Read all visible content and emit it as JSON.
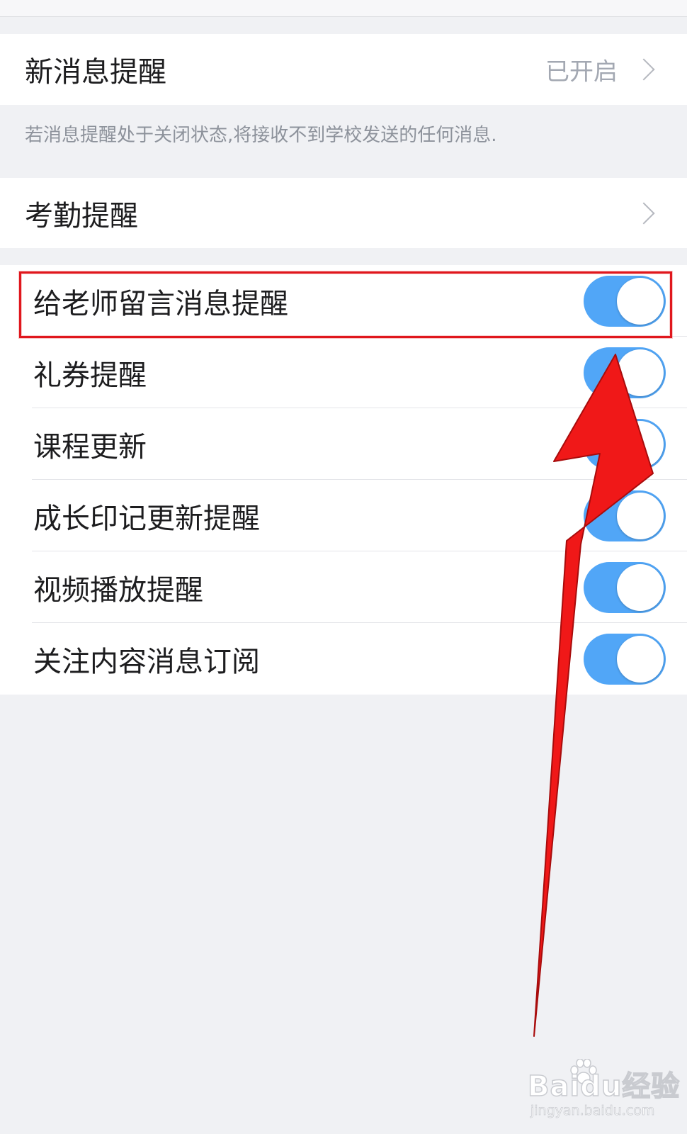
{
  "notification_row": {
    "title": "新消息提醒",
    "value": "已开启"
  },
  "notification_hint": "若消息提醒处于关闭状态,将接收不到学校发送的任何消息.",
  "attendance_row": {
    "title": "考勤提醒"
  },
  "toggles": [
    {
      "label": "给老师留言消息提醒",
      "on": true
    },
    {
      "label": "礼券提醒",
      "on": true
    },
    {
      "label": "课程更新",
      "on": true
    },
    {
      "label": "成长印记更新提醒",
      "on": true
    },
    {
      "label": "视频播放提醒",
      "on": true
    },
    {
      "label": "关注内容消息订阅",
      "on": true
    }
  ],
  "colors": {
    "toggle_on": "#51a6f7",
    "annotation": "#e0171d",
    "background": "#f0f1f4"
  },
  "watermark": {
    "logo": "Baidu经验",
    "url": "jingyan.baidu.com"
  }
}
